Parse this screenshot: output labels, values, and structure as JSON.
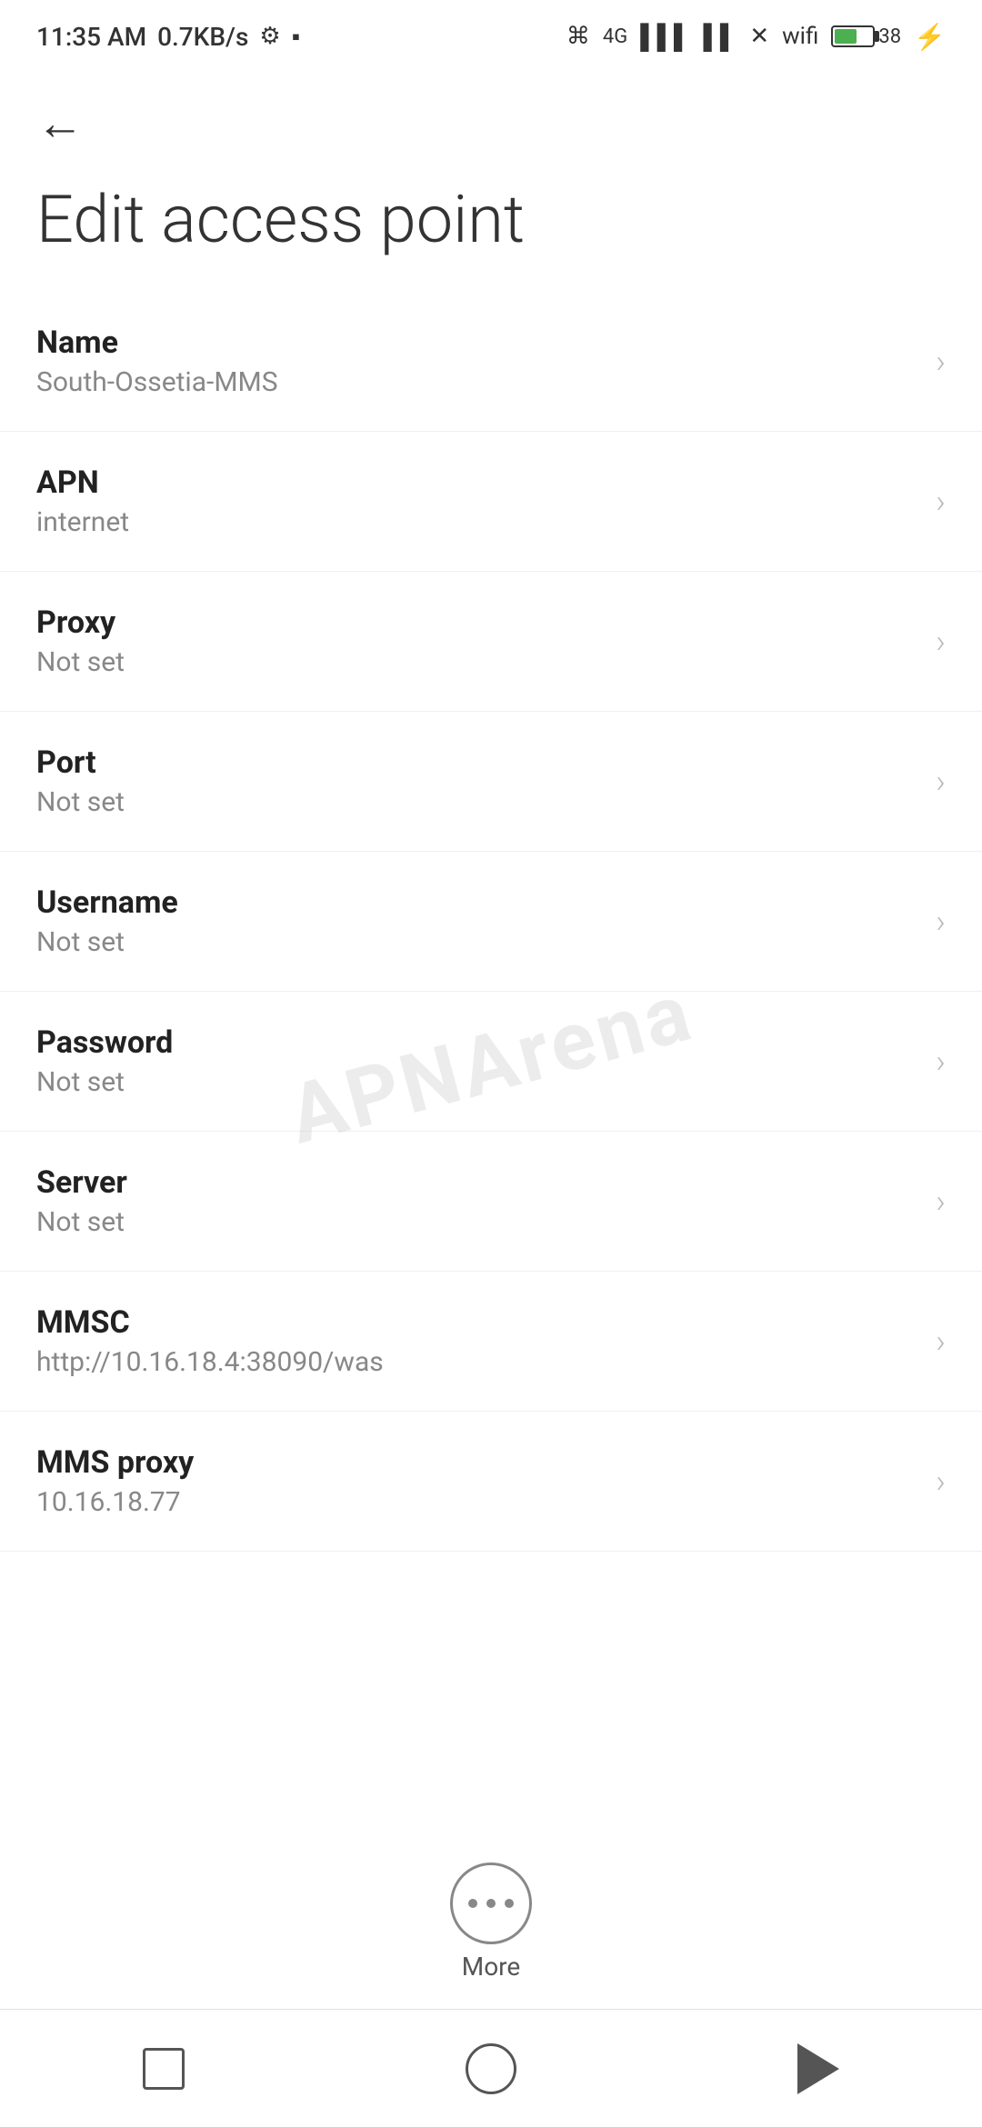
{
  "statusBar": {
    "time": "11:35 AM",
    "network": "0.7KB/s",
    "batteryPercent": "38"
  },
  "navigation": {
    "backLabel": "←"
  },
  "pageTitle": "Edit access point",
  "settingsItems": [
    {
      "label": "Name",
      "value": "South-Ossetia-MMS"
    },
    {
      "label": "APN",
      "value": "internet"
    },
    {
      "label": "Proxy",
      "value": "Not set"
    },
    {
      "label": "Port",
      "value": "Not set"
    },
    {
      "label": "Username",
      "value": "Not set"
    },
    {
      "label": "Password",
      "value": "Not set"
    },
    {
      "label": "Server",
      "value": "Not set"
    },
    {
      "label": "MMSC",
      "value": "http://10.16.18.4:38090/was"
    },
    {
      "label": "MMS proxy",
      "value": "10.16.18.77"
    }
  ],
  "more": {
    "label": "More"
  },
  "watermark": "APNArena"
}
